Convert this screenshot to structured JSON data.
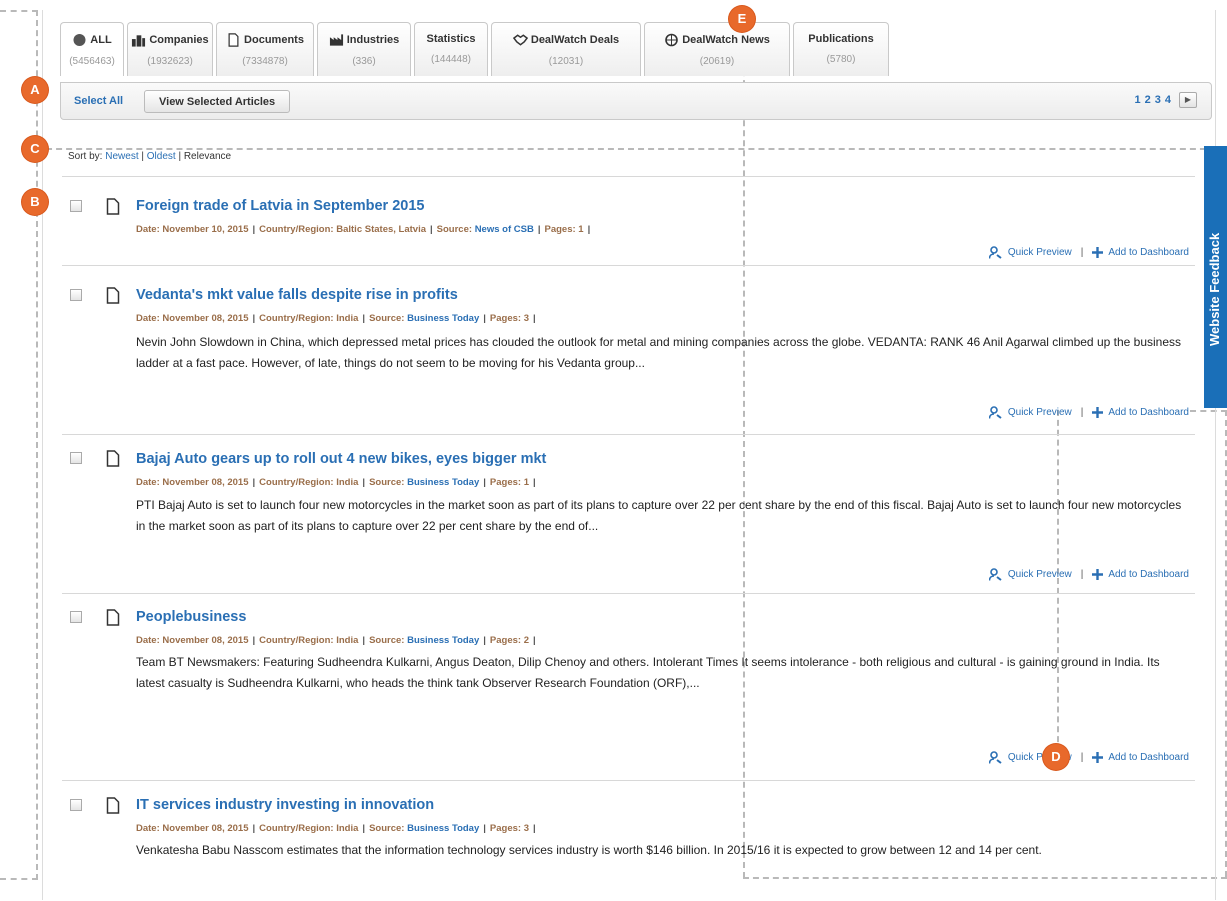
{
  "tabs": [
    {
      "label": "ALL",
      "count": "(5456463)",
      "icon": "globe-icon"
    },
    {
      "label": "Companies",
      "count": "(1932623)",
      "icon": "companies-icon"
    },
    {
      "label": "Documents",
      "count": "(7334878)",
      "icon": "document-icon"
    },
    {
      "label": "Industries",
      "count": "(336)",
      "icon": "factory-icon"
    },
    {
      "label": "Statistics",
      "count": "(144448)",
      "icon": ""
    },
    {
      "label": "DealWatch Deals",
      "count": "(12031)",
      "icon": "handshake-icon"
    },
    {
      "label": "DealWatch News",
      "count": "(20619)",
      "icon": "news-globe-icon"
    },
    {
      "label": "Publications",
      "count": "(5780)",
      "icon": ""
    }
  ],
  "actionbar": {
    "select_all": "Select All",
    "view_selected": "View Selected Articles",
    "pages": [
      "1",
      "2",
      "3",
      "4"
    ],
    "next": "▶"
  },
  "sort": {
    "prefix": "Sort by: ",
    "newest": "Newest",
    "divider": " | ",
    "oldest": "Oldest",
    "relevance": "Relevance"
  },
  "feedback": "Website Feedback",
  "labels": {
    "date": "Date: ",
    "country": "Country/Region: ",
    "source": "Source: ",
    "pages": "Pages: ",
    "quick_preview": "Quick Preview",
    "add_dashboard": "Add to Dashboard"
  },
  "articles": [
    {
      "title": "Foreign trade of Latvia in September 2015",
      "date": "November 10, 2015",
      "country": "Baltic States, Latvia",
      "source": "News of CSB",
      "pages": "1",
      "summary": ""
    },
    {
      "title": "Vedanta's mkt value falls despite rise in profits",
      "date": "November 08, 2015",
      "country": "India",
      "source": "Business Today",
      "pages": "3",
      "summary": "Nevin John Slowdown in China, which depressed metal prices has clouded the outlook for metal and mining companies across the globe. VEDANTA: RANK 46 Anil Agarwal climbed up the business ladder at a fast pace. However, of late, things do not seem to be moving for his Vedanta group..."
    },
    {
      "title": "Bajaj Auto gears up to roll out 4 new bikes, eyes bigger mkt",
      "date": "November 08, 2015",
      "country": "India",
      "source": "Business Today",
      "pages": "1",
      "summary": "PTI Bajaj Auto is set to launch four new motorcycles in the market soon as part of its plans to capture over 22 per cent share by the end of this fiscal. Bajaj Auto is set to launch four new motorcycles in the market soon as part of its plans to capture over 22 per cent share by the end of..."
    },
    {
      "title": "Peoplebusiness",
      "date": "November 08, 2015",
      "country": "India",
      "source": "Business Today",
      "pages": "2",
      "summary": "Team BT Newsmakers: Featuring Sudheendra Kulkarni, Angus Deaton, Dilip Chenoy and others. Intolerant Times It seems intolerance - both religious and cultural - is gaining ground in India. Its latest casualty is Sudheendra Kulkarni, who heads the think tank Observer Research Foundation (ORF),..."
    },
    {
      "title": "IT services industry investing in innovation",
      "date": "November 08, 2015",
      "country": "India",
      "source": "Business Today",
      "pages": "3",
      "summary": "Venkatesha Babu Nasscom estimates that the information technology services industry is worth $146 billion. In 2015/16 it is expected to grow between 12 and 14 per cent."
    }
  ],
  "markers": [
    "A",
    "B",
    "C",
    "D",
    "E"
  ],
  "colors": {
    "link": "#2a6fb4",
    "meta": "#9a6e4a",
    "marker": "#e8692b",
    "feedback": "#1a6fb8"
  }
}
